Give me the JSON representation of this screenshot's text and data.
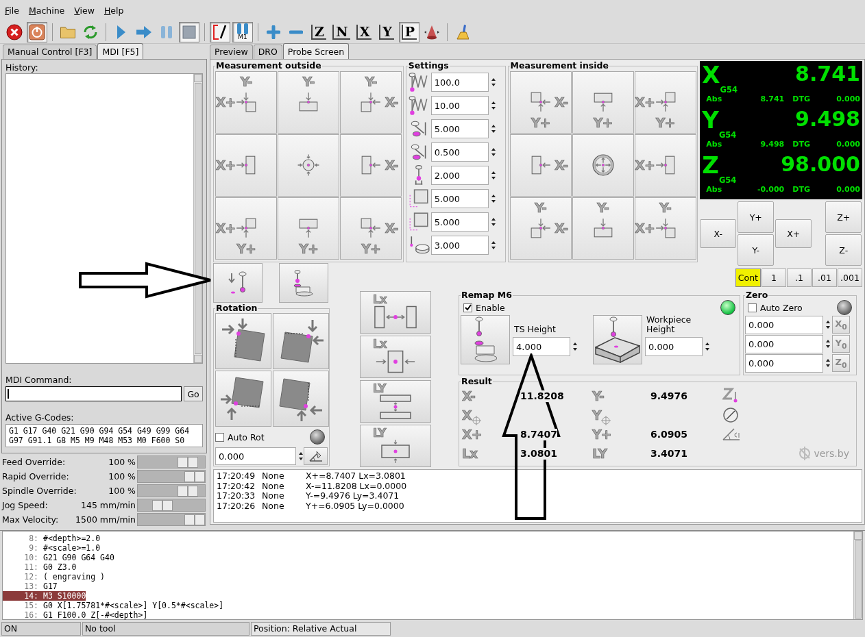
{
  "menu": [
    {
      "label": "File"
    },
    {
      "label": "Machine"
    },
    {
      "label": "View"
    },
    {
      "label": "Help"
    }
  ],
  "toolbar": [
    [
      {
        "kind": "estop",
        "pressed": false
      },
      {
        "kind": "power",
        "pressed": true
      }
    ],
    [
      {
        "kind": "open",
        "pressed": false
      },
      {
        "kind": "reload",
        "pressed": false
      }
    ],
    [
      {
        "kind": "run",
        "pressed": false
      },
      {
        "kind": "step",
        "pressed": false
      },
      {
        "kind": "pause",
        "pressed": false
      },
      {
        "kind": "stop",
        "pressed": true
      }
    ],
    [
      {
        "kind": "blockdelete",
        "pressed": true
      },
      {
        "kind": "optstop",
        "text": "M1",
        "pressed": true
      }
    ],
    [
      {
        "kind": "zoomin",
        "pressed": false
      },
      {
        "kind": "zoomout",
        "pressed": false
      },
      {
        "kind": "view",
        "text": "Z",
        "pressed": false
      },
      {
        "kind": "view",
        "text": "N",
        "pressed": false
      },
      {
        "kind": "view",
        "text": "X",
        "pressed": false
      },
      {
        "kind": "view",
        "text": "Y",
        "pressed": false
      },
      {
        "kind": "view",
        "text": "P",
        "pressed": true
      },
      {
        "kind": "rotate",
        "pressed": false
      }
    ],
    [
      {
        "kind": "clear",
        "pressed": false
      }
    ]
  ],
  "left_tabs": [
    {
      "label": "Manual Control [F3]",
      "selected": false
    },
    {
      "label": "MDI [F5]",
      "selected": true
    }
  ],
  "mdi": {
    "history_label": "History:",
    "command_label": "MDI Command:",
    "go_button": "Go",
    "gcodes_label": "Active G-Codes:",
    "gcodes": [
      "G1 G17 G40 G21 G90 G94 G54 G49 G99 G64",
      "G97 G91.1 G8 M5 M9 M48 M53 M0 F600 S0"
    ]
  },
  "sliders": [
    {
      "label": "Feed Override:",
      "value": "100 %",
      "level": 0.86
    },
    {
      "label": "Rapid Override:",
      "value": "100 %",
      "level": 1
    },
    {
      "label": "Spindle Override:",
      "value": "100 %",
      "level": 0.86
    },
    {
      "label": "Jog Speed:",
      "value": "145 mm/min",
      "level": 0.31
    },
    {
      "label": "Max Velocity:",
      "value": "1500 mm/min",
      "level": 1
    }
  ],
  "right_tabs": [
    {
      "label": "Preview",
      "selected": false
    },
    {
      "label": "DRO",
      "selected": false
    },
    {
      "label": "Probe Screen",
      "selected": true
    }
  ],
  "measurement_outside": {
    "title": "Measurement outside",
    "buttons": [
      {
        "kind": "corner",
        "top": "Y-",
        "left": "X+"
      },
      {
        "kind": "edge",
        "top": "Y-"
      },
      {
        "kind": "corner",
        "top": "Y-",
        "right": "X-"
      },
      {
        "kind": "edge",
        "left": "X+"
      },
      {
        "kind": "circle"
      },
      {
        "kind": "edge",
        "right": "X-"
      },
      {
        "kind": "corner",
        "left": "X+",
        "bottom": "Y+"
      },
      {
        "kind": "edge",
        "bottom": "Y+"
      },
      {
        "kind": "corner",
        "right": "X-",
        "bottom": "Y+"
      }
    ]
  },
  "settings": {
    "title": "Settings",
    "rows": [
      {
        "kind": "zigzag",
        "value": "100.0"
      },
      {
        "kind": "zigzag",
        "value": "10.00"
      },
      {
        "kind": "lever",
        "value": "5.000"
      },
      {
        "kind": "lever",
        "value": "0.500"
      },
      {
        "kind": "stylus",
        "value": "2.000"
      },
      {
        "kind": "square",
        "value": "5.000"
      },
      {
        "kind": "square",
        "value": "5.000"
      },
      {
        "kind": "puck",
        "value": "3.000"
      }
    ]
  },
  "measurement_inside": {
    "title": "Measurement inside",
    "buttons": [
      {
        "kind": "corner",
        "right": "X-",
        "bottom": "Y+"
      },
      {
        "kind": "edge",
        "bottom": "Y+"
      },
      {
        "kind": "corner",
        "left": "X+",
        "bottom": "Y+"
      },
      {
        "kind": "edge",
        "right": "X-"
      },
      {
        "kind": "hole"
      },
      {
        "kind": "edge",
        "left": "X+"
      },
      {
        "kind": "corner",
        "top": "Y-",
        "right": "X-"
      },
      {
        "kind": "edge",
        "top": "Y-"
      },
      {
        "kind": "corner",
        "top": "Y-",
        "left": "X+"
      }
    ]
  },
  "dro": {
    "axes": [
      {
        "axis": "X",
        "offset": "G54",
        "value": "8.741",
        "abs_label": "Abs",
        "abs": "8.741",
        "dtg_label": "DTG",
        "dtg": "0.000"
      },
      {
        "axis": "Y",
        "offset": "G54",
        "value": "9.498",
        "abs_label": "Abs",
        "abs": "9.498",
        "dtg_label": "DTG",
        "dtg": "0.000"
      },
      {
        "axis": "Z",
        "offset": "G54",
        "value": "98.000",
        "abs_label": "Abs",
        "abs": "-0.000",
        "dtg_label": "DTG",
        "dtg": "0.000"
      }
    ]
  },
  "jog": {
    "buttons": [
      {
        "label": "X-"
      },
      {
        "label": "Y+"
      },
      {
        "label": "Y-"
      },
      {
        "label": "X+"
      },
      {
        "label": "Z+"
      },
      {
        "label": "Z-"
      }
    ],
    "increments": [
      {
        "label": "Cont",
        "selected": true
      },
      {
        "label": "1",
        "selected": false
      },
      {
        "label": ".1",
        "selected": false
      },
      {
        "label": ".01",
        "selected": false
      },
      {
        "label": ".001",
        "selected": false
      }
    ]
  },
  "tool_buttons": [
    {
      "kind": "probe"
    },
    {
      "kind": "toolsetter"
    }
  ],
  "rotation": {
    "title": "Rotation",
    "buttons": [
      {
        "kind": "rotation"
      },
      {
        "kind": "rotation"
      },
      {
        "kind": "rotation"
      },
      {
        "kind": "rotation"
      }
    ],
    "auto_rot": {
      "label": "Auto Rot",
      "checked": false
    },
    "led_on": false,
    "angle": "0.000"
  },
  "length_buttons": [
    {
      "label": "Lx",
      "kind": "between"
    },
    {
      "label": "Lx",
      "kind": "around"
    },
    {
      "label": "LY",
      "kind": "between"
    },
    {
      "label": "LY",
      "kind": "around"
    }
  ],
  "remap": {
    "title": "Remap M6",
    "enable": {
      "label": "Enable",
      "checked": true
    },
    "led_on": true,
    "ts_label": "TS Height",
    "ts_value": "4.000",
    "wp_label": "Workpiece Height",
    "wp_value": "0.000"
  },
  "zero": {
    "title": "Zero",
    "auto_zero": {
      "label": "Auto Zero",
      "checked": false
    },
    "led_on": false,
    "rows": [
      {
        "value": "0.000",
        "button": "X$_{0}$"
      },
      {
        "value": "0.000",
        "button": "Y$_{0}$"
      },
      {
        "value": "0.000",
        "button": "Z$_{0}$"
      }
    ]
  },
  "result": {
    "title": "Result",
    "rows": [
      {
        "kind": "min",
        "x_label": "X-",
        "x_value": "11.8208",
        "y_label": "Y-",
        "y_value": "9.4976"
      },
      {
        "kind": "center",
        "x_label": "X",
        "y_label": "Y"
      },
      {
        "kind": "max",
        "x_label": "X+",
        "x_value": "8.7407",
        "y_label": "Y+",
        "y_value": "6.0905"
      },
      {
        "kind": "length",
        "x_label": "Lx",
        "x_value": "3.0801",
        "y_label": "LY",
        "y_value": "3.4071"
      }
    ],
    "logo": "vers.by"
  },
  "log": [
    {
      "time": "17:20:49",
      "status": "None",
      "text": "X+=8.7407 Lx=3.0801"
    },
    {
      "time": "17:20:42",
      "status": "None",
      "text": "X-=11.8208 Lx=0.0000"
    },
    {
      "time": "17:20:33",
      "status": "None",
      "text": "Y-=9.4976 Ly=3.4071"
    },
    {
      "time": "17:20:26",
      "status": "None",
      "text": "Y+=6.0905 Ly=0.0000"
    }
  ],
  "code": [
    {
      "number": "8:",
      "text": "#<depth>=2.0",
      "selected": false
    },
    {
      "number": "9:",
      "text": "#<scale>=1.0",
      "selected": false
    },
    {
      "number": "10:",
      "text": "G21 G90 G64 G40",
      "selected": false
    },
    {
      "number": "11:",
      "text": "G0 Z3.0",
      "selected": false
    },
    {
      "number": "12:",
      "text": "( engraving )",
      "selected": false
    },
    {
      "number": "13:",
      "text": "G17",
      "selected": false
    },
    {
      "number": "14:",
      "text": "M3 S10000",
      "selected": true
    },
    {
      "number": "15:",
      "text": "G0 X[1.75781*#<scale>] Y[0.5*#<scale>]",
      "selected": false
    },
    {
      "number": "16:",
      "text": "G1 F100.0 Z[-#<depth>]",
      "selected": false
    }
  ],
  "status": [
    {
      "text": "ON"
    },
    {
      "text": "No tool"
    },
    {
      "text": "Position: Relative Actual"
    }
  ],
  "callouts": [
    {
      "kind": "right"
    },
    {
      "kind": "up"
    }
  ]
}
